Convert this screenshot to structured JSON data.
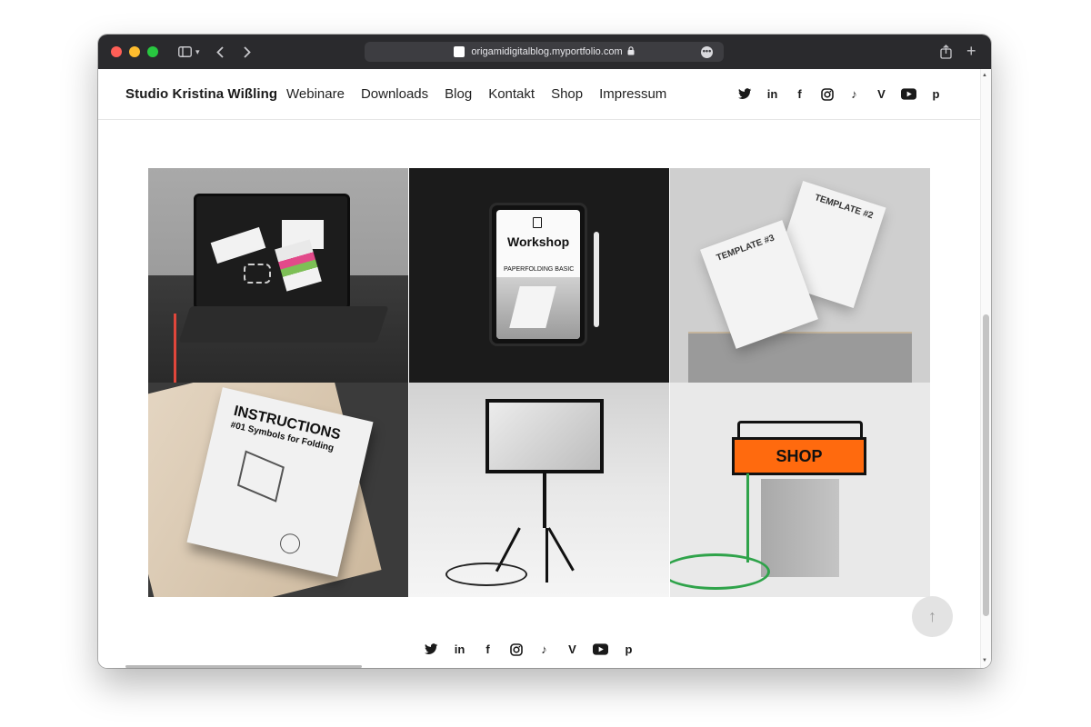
{
  "browser": {
    "url": "origamidigitalblog.myportfolio.com",
    "more_label": "•••",
    "newtab_label": "+",
    "back_label": "‹",
    "forward_label": "›"
  },
  "site": {
    "brand": "Studio Kristina Wißling",
    "menu": [
      "Webinare",
      "Downloads",
      "Blog",
      "Kontakt",
      "Shop",
      "Impressum"
    ],
    "social": [
      "twitter-icon",
      "linkedin-icon",
      "facebook-icon",
      "instagram-icon",
      "tiktok-icon",
      "vimeo-icon",
      "youtube-icon",
      "pinterest-icon"
    ]
  },
  "gallery": {
    "tiles": [
      {
        "name": "laptop-mockup"
      },
      {
        "name": "workshop-tablet",
        "title": "Workshop",
        "subtitle": "PAPERFOLDING BASIC"
      },
      {
        "name": "templates",
        "t1": "TEMPLATE #2",
        "t2": "TEMPLATE #3"
      },
      {
        "name": "instructions-booklet",
        "title": "INSTRUCTIONS",
        "subtitle": "#01 Symbols for Folding"
      },
      {
        "name": "screen-on-stand"
      },
      {
        "name": "shop-sign",
        "label": "SHOP"
      }
    ]
  },
  "colors": {
    "accent_orange": "#ff6a0e",
    "cable_green": "#2fa34a"
  },
  "to_top_label": "↑"
}
